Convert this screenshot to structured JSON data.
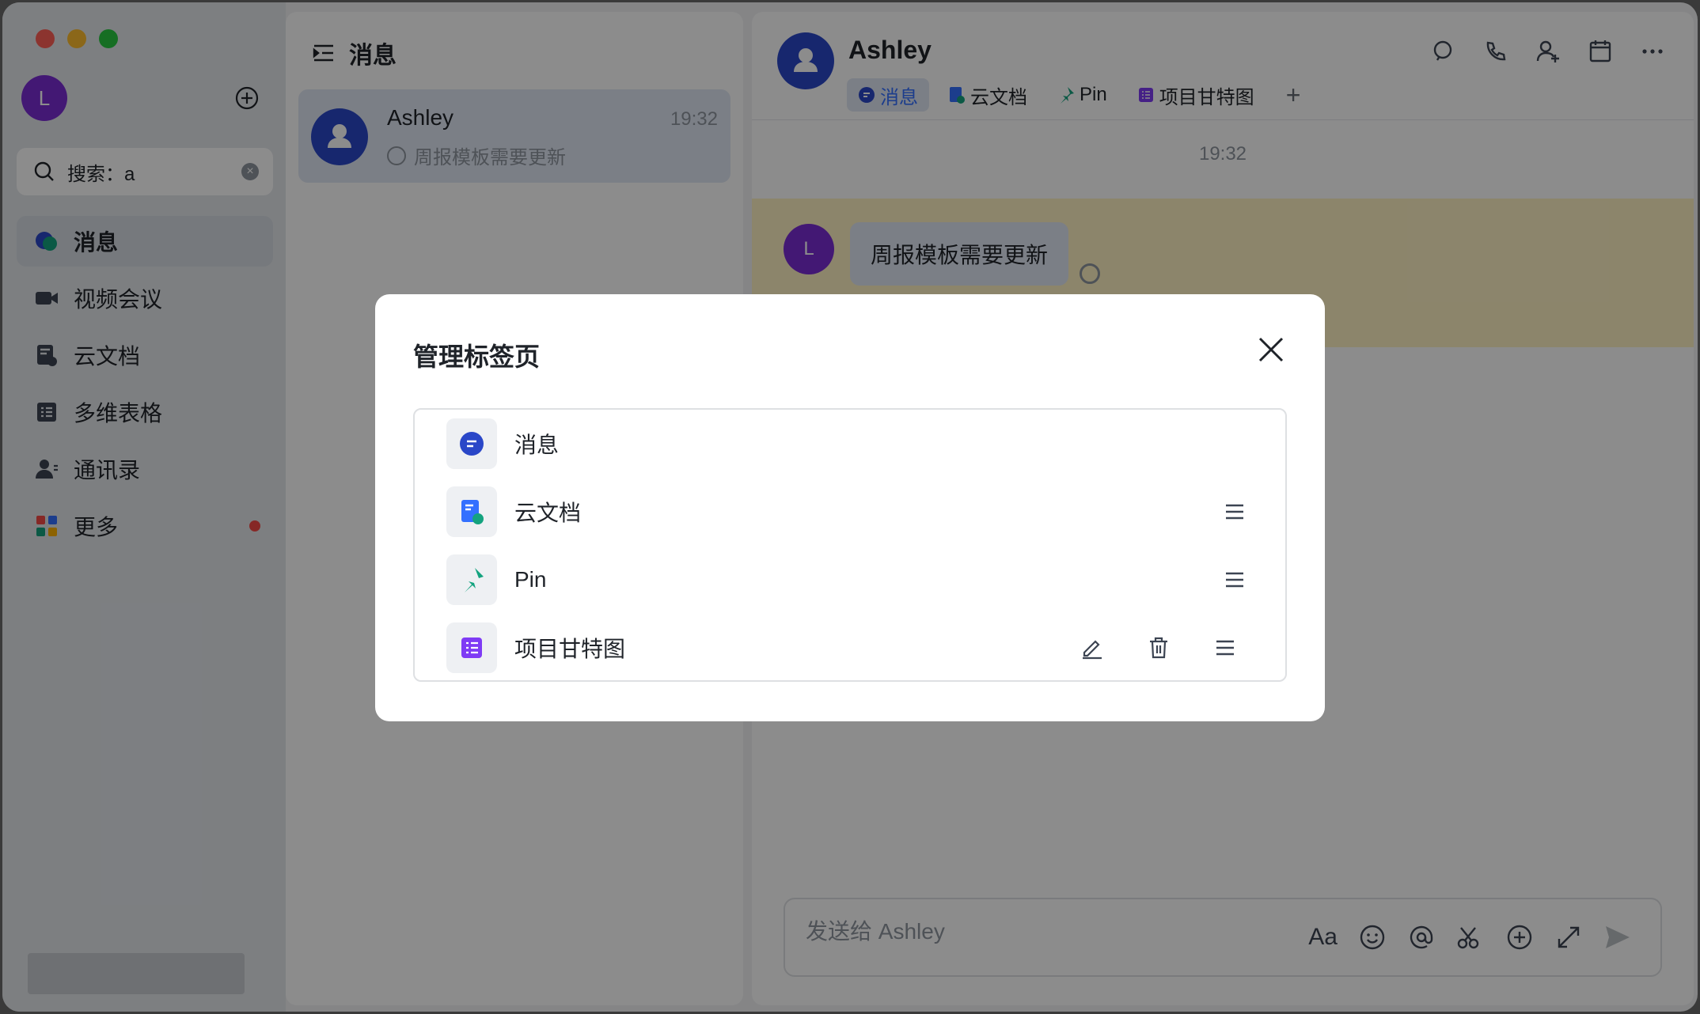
{
  "sidebar": {
    "avatar_letter": "L",
    "search": {
      "value": "搜索：a"
    },
    "items": [
      {
        "label": "消息",
        "icon": "chat-bubble-icon",
        "active": true
      },
      {
        "label": "视频会议",
        "icon": "video-camera-icon"
      },
      {
        "label": "云文档",
        "icon": "cloud-doc-icon"
      },
      {
        "label": "多维表格",
        "icon": "table-icon"
      },
      {
        "label": "通讯录",
        "icon": "contacts-icon"
      },
      {
        "label": "更多",
        "icon": "apps-icon",
        "badge_dot": true
      }
    ]
  },
  "chat_list": {
    "title": "消息",
    "conversations": [
      {
        "name": "Ashley",
        "time": "19:32",
        "preview": "周报模板需要更新"
      }
    ]
  },
  "chat": {
    "name": "Ashley",
    "tabs": [
      {
        "label": "消息",
        "icon": "chat-bubble-icon",
        "active": true
      },
      {
        "label": "云文档",
        "icon": "cloud-doc-icon"
      },
      {
        "label": "Pin",
        "icon": "pin-icon"
      },
      {
        "label": "项目甘特图",
        "icon": "gantt-icon"
      }
    ],
    "add_tab": "+",
    "timestamp": "19:32",
    "message": {
      "sender_letter": "L",
      "text": "周报模板需要更新"
    },
    "composer_placeholder": "发送给 Ashley",
    "composer_font_tool": "Aa"
  },
  "modal": {
    "title": "管理标签页",
    "tabs": [
      {
        "label": "消息",
        "icon": "chat-bubble-icon",
        "icon_color": "#2a47c8"
      },
      {
        "label": "云文档",
        "icon": "cloud-doc-icon",
        "icon_color": "#3370ff"
      },
      {
        "label": "Pin",
        "icon": "pin-icon",
        "icon_color": "#14a37f"
      },
      {
        "label": "项目甘特图",
        "icon": "gantt-icon",
        "icon_color": "#7f3bf5"
      }
    ]
  },
  "colors": {
    "accent": "#3370ff",
    "message_highlight": "#fff3c4",
    "badge": "#f54a45"
  }
}
